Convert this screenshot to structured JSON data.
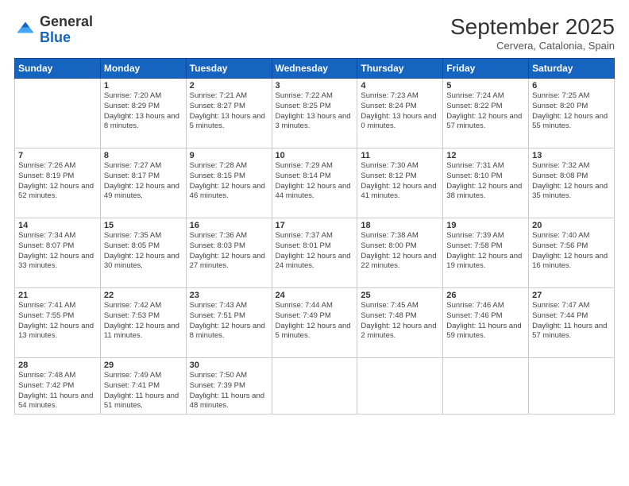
{
  "logo": {
    "general": "General",
    "blue": "Blue"
  },
  "header": {
    "month_year": "September 2025",
    "location": "Cervera, Catalonia, Spain"
  },
  "weekdays": [
    "Sunday",
    "Monday",
    "Tuesday",
    "Wednesday",
    "Thursday",
    "Friday",
    "Saturday"
  ],
  "weeks": [
    [
      {
        "day": "",
        "sunrise": "",
        "sunset": "",
        "daylight": ""
      },
      {
        "day": "1",
        "sunrise": "Sunrise: 7:20 AM",
        "sunset": "Sunset: 8:29 PM",
        "daylight": "Daylight: 13 hours and 8 minutes."
      },
      {
        "day": "2",
        "sunrise": "Sunrise: 7:21 AM",
        "sunset": "Sunset: 8:27 PM",
        "daylight": "Daylight: 13 hours and 5 minutes."
      },
      {
        "day": "3",
        "sunrise": "Sunrise: 7:22 AM",
        "sunset": "Sunset: 8:25 PM",
        "daylight": "Daylight: 13 hours and 3 minutes."
      },
      {
        "day": "4",
        "sunrise": "Sunrise: 7:23 AM",
        "sunset": "Sunset: 8:24 PM",
        "daylight": "Daylight: 13 hours and 0 minutes."
      },
      {
        "day": "5",
        "sunrise": "Sunrise: 7:24 AM",
        "sunset": "Sunset: 8:22 PM",
        "daylight": "Daylight: 12 hours and 57 minutes."
      },
      {
        "day": "6",
        "sunrise": "Sunrise: 7:25 AM",
        "sunset": "Sunset: 8:20 PM",
        "daylight": "Daylight: 12 hours and 55 minutes."
      }
    ],
    [
      {
        "day": "7",
        "sunrise": "Sunrise: 7:26 AM",
        "sunset": "Sunset: 8:19 PM",
        "daylight": "Daylight: 12 hours and 52 minutes."
      },
      {
        "day": "8",
        "sunrise": "Sunrise: 7:27 AM",
        "sunset": "Sunset: 8:17 PM",
        "daylight": "Daylight: 12 hours and 49 minutes."
      },
      {
        "day": "9",
        "sunrise": "Sunrise: 7:28 AM",
        "sunset": "Sunset: 8:15 PM",
        "daylight": "Daylight: 12 hours and 46 minutes."
      },
      {
        "day": "10",
        "sunrise": "Sunrise: 7:29 AM",
        "sunset": "Sunset: 8:14 PM",
        "daylight": "Daylight: 12 hours and 44 minutes."
      },
      {
        "day": "11",
        "sunrise": "Sunrise: 7:30 AM",
        "sunset": "Sunset: 8:12 PM",
        "daylight": "Daylight: 12 hours and 41 minutes."
      },
      {
        "day": "12",
        "sunrise": "Sunrise: 7:31 AM",
        "sunset": "Sunset: 8:10 PM",
        "daylight": "Daylight: 12 hours and 38 minutes."
      },
      {
        "day": "13",
        "sunrise": "Sunrise: 7:32 AM",
        "sunset": "Sunset: 8:08 PM",
        "daylight": "Daylight: 12 hours and 35 minutes."
      }
    ],
    [
      {
        "day": "14",
        "sunrise": "Sunrise: 7:34 AM",
        "sunset": "Sunset: 8:07 PM",
        "daylight": "Daylight: 12 hours and 33 minutes."
      },
      {
        "day": "15",
        "sunrise": "Sunrise: 7:35 AM",
        "sunset": "Sunset: 8:05 PM",
        "daylight": "Daylight: 12 hours and 30 minutes."
      },
      {
        "day": "16",
        "sunrise": "Sunrise: 7:36 AM",
        "sunset": "Sunset: 8:03 PM",
        "daylight": "Daylight: 12 hours and 27 minutes."
      },
      {
        "day": "17",
        "sunrise": "Sunrise: 7:37 AM",
        "sunset": "Sunset: 8:01 PM",
        "daylight": "Daylight: 12 hours and 24 minutes."
      },
      {
        "day": "18",
        "sunrise": "Sunrise: 7:38 AM",
        "sunset": "Sunset: 8:00 PM",
        "daylight": "Daylight: 12 hours and 22 minutes."
      },
      {
        "day": "19",
        "sunrise": "Sunrise: 7:39 AM",
        "sunset": "Sunset: 7:58 PM",
        "daylight": "Daylight: 12 hours and 19 minutes."
      },
      {
        "day": "20",
        "sunrise": "Sunrise: 7:40 AM",
        "sunset": "Sunset: 7:56 PM",
        "daylight": "Daylight: 12 hours and 16 minutes."
      }
    ],
    [
      {
        "day": "21",
        "sunrise": "Sunrise: 7:41 AM",
        "sunset": "Sunset: 7:55 PM",
        "daylight": "Daylight: 12 hours and 13 minutes."
      },
      {
        "day": "22",
        "sunrise": "Sunrise: 7:42 AM",
        "sunset": "Sunset: 7:53 PM",
        "daylight": "Daylight: 12 hours and 11 minutes."
      },
      {
        "day": "23",
        "sunrise": "Sunrise: 7:43 AM",
        "sunset": "Sunset: 7:51 PM",
        "daylight": "Daylight: 12 hours and 8 minutes."
      },
      {
        "day": "24",
        "sunrise": "Sunrise: 7:44 AM",
        "sunset": "Sunset: 7:49 PM",
        "daylight": "Daylight: 12 hours and 5 minutes."
      },
      {
        "day": "25",
        "sunrise": "Sunrise: 7:45 AM",
        "sunset": "Sunset: 7:48 PM",
        "daylight": "Daylight: 12 hours and 2 minutes."
      },
      {
        "day": "26",
        "sunrise": "Sunrise: 7:46 AM",
        "sunset": "Sunset: 7:46 PM",
        "daylight": "Daylight: 11 hours and 59 minutes."
      },
      {
        "day": "27",
        "sunrise": "Sunrise: 7:47 AM",
        "sunset": "Sunset: 7:44 PM",
        "daylight": "Daylight: 11 hours and 57 minutes."
      }
    ],
    [
      {
        "day": "28",
        "sunrise": "Sunrise: 7:48 AM",
        "sunset": "Sunset: 7:42 PM",
        "daylight": "Daylight: 11 hours and 54 minutes."
      },
      {
        "day": "29",
        "sunrise": "Sunrise: 7:49 AM",
        "sunset": "Sunset: 7:41 PM",
        "daylight": "Daylight: 11 hours and 51 minutes."
      },
      {
        "day": "30",
        "sunrise": "Sunrise: 7:50 AM",
        "sunset": "Sunset: 7:39 PM",
        "daylight": "Daylight: 11 hours and 48 minutes."
      },
      {
        "day": "",
        "sunrise": "",
        "sunset": "",
        "daylight": ""
      },
      {
        "day": "",
        "sunrise": "",
        "sunset": "",
        "daylight": ""
      },
      {
        "day": "",
        "sunrise": "",
        "sunset": "",
        "daylight": ""
      },
      {
        "day": "",
        "sunrise": "",
        "sunset": "",
        "daylight": ""
      }
    ]
  ]
}
